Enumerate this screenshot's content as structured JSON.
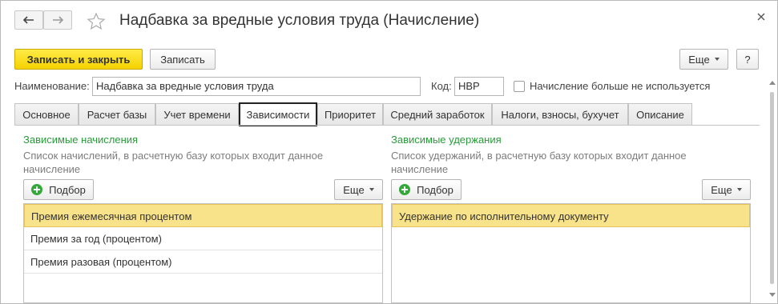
{
  "window": {
    "title": "Надбавка за вредные условия труда (Начисление)"
  },
  "toolbar": {
    "save_close_label": "Записать и закрыть",
    "save_label": "Записать",
    "more_label": "Еще",
    "help_label": "?"
  },
  "fields": {
    "name_label": "Наименование:",
    "name_value": "Надбавка за вредные условия труда",
    "code_label": "Код:",
    "code_value": "НВР",
    "unused_label": "Начисление больше не используется",
    "unused_checked": false
  },
  "tabs": [
    {
      "label": "Основное"
    },
    {
      "label": "Расчет базы"
    },
    {
      "label": "Учет времени"
    },
    {
      "label": "Зависимости"
    },
    {
      "label": "Приоритет"
    },
    {
      "label": "Средний заработок"
    },
    {
      "label": "Налоги, взносы, бухучет"
    },
    {
      "label": "Описание"
    }
  ],
  "active_tab": "Зависимости",
  "left_panel": {
    "title": "Зависимые начисления",
    "description": "Список начислений, в расчетную базу которых входит данное начисление",
    "pick_label": "Подбор",
    "more_label": "Еще",
    "items": [
      {
        "label": "Премия ежемесячная процентом",
        "selected": true
      },
      {
        "label": "Премия за год (процентом)",
        "selected": false
      },
      {
        "label": "Премия разовая (процентом)",
        "selected": false
      }
    ]
  },
  "right_panel": {
    "title": "Зависимые удержания",
    "description": "Список удержаний, в расчетную базу которых входит данное начисление",
    "pick_label": "Подбор",
    "more_label": "Еще",
    "items": [
      {
        "label": "Удержание по исполнительному документу",
        "selected": true
      }
    ]
  },
  "colors": {
    "primary_button": "#f5d200",
    "section_title": "#2a9a3a",
    "selected_row": "#f9e38a"
  }
}
